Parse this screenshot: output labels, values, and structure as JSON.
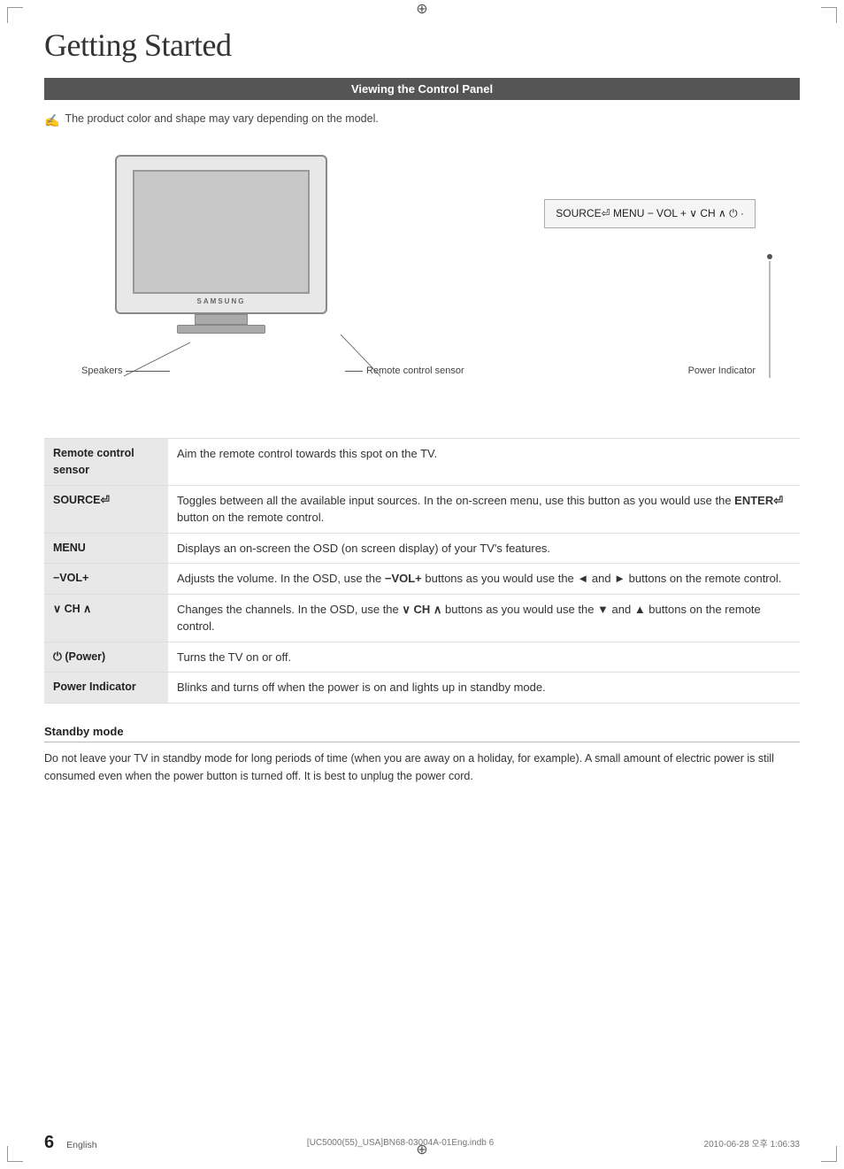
{
  "page": {
    "title": "Getting Started",
    "corner_marks": true
  },
  "section": {
    "header": "Viewing the Control Panel",
    "note": "The product color and shape may vary depending on the model."
  },
  "diagram": {
    "tv_brand": "SAMSUNG",
    "speakers_label": "Speakers",
    "remote_sensor_label": "Remote control sensor",
    "power_indicator_label": "Power Indicator",
    "control_panel_text": "SOURCE⏎  MENU  − VOL +   ∨ CH ∧  ⏻  ·"
  },
  "table": {
    "rows": [
      {
        "label": "Remote control sensor",
        "description": "Aim the remote control towards this spot on the TV."
      },
      {
        "label": "SOURCE⏎",
        "description": "Toggles between all the available input sources. In the on-screen menu, use this button as you would use the ENTER⏎ button on the remote control."
      },
      {
        "label": "MENU",
        "description": "Displays an on-screen the OSD (on screen display) of your TV's features."
      },
      {
        "label": "−VOL+",
        "description": "Adjusts the volume. In the OSD, use the −VOL+ buttons as you would use the ◄ and ► buttons on the remote control."
      },
      {
        "label": "∨ CH ∧",
        "description": "Changes the channels. In the OSD, use the ∨ CH ∧ buttons as you would use the ▼ and ▲ buttons on the remote control."
      },
      {
        "label": "⏻ (Power)",
        "description": "Turns the TV on or off."
      },
      {
        "label": "Power Indicator",
        "description": "Blinks and turns off when the power is on and lights up in standby mode."
      }
    ]
  },
  "standby": {
    "title": "Standby mode",
    "text": "Do not leave your TV in standby mode for long periods of time (when you are away on a holiday, for example). A small amount of electric power is still consumed even when the power button is turned off. It is best to unplug the power cord."
  },
  "footer": {
    "page_number": "6",
    "language": "English",
    "file_info": "[UC5000(55)_USA]BN68-03004A-01Eng.indb  6",
    "date_info": "2010-06-28   오후 1:06:33"
  }
}
